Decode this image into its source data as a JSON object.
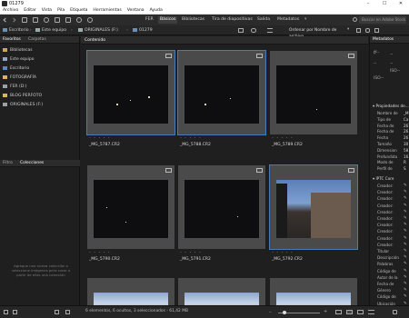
{
  "window": {
    "title": "01279"
  },
  "menu": [
    "Archivo",
    "Editar",
    "Vista",
    "Pila",
    "Etiqueta",
    "Herramientas",
    "Ventana",
    "Ayuda"
  ],
  "workspace": {
    "tabs": [
      "FER",
      "Básicos",
      "Bibliotecas",
      "Tira de diapositivas",
      "Salida",
      "Metadatos"
    ],
    "active": "Básicos",
    "search_placeholder": "Buscar en Adobe Stock"
  },
  "path": {
    "items": [
      "Escritorio",
      "Este equipo",
      "ORIGINALES (F:)",
      "01279"
    ],
    "sort_label": "Ordenar por Nombre de archivo"
  },
  "left_panel": {
    "tabs": [
      "Favoritos",
      "Carpetas"
    ],
    "favorites": [
      {
        "label": "Bibliotecas",
        "color": "#c9a85a"
      },
      {
        "label": "Este equipo",
        "color": "#8fa7c4"
      },
      {
        "label": "Escritorio",
        "color": "#5a86c9"
      },
      {
        "label": "FOTOGRAFÍA",
        "color": "#d9b45a"
      },
      {
        "label": "FER (D:)",
        "color": "#9aa0a6"
      },
      {
        "label": "BLOG PERFOTO",
        "color": "#d9b45a"
      },
      {
        "label": "ORIGINALES (F:)",
        "color": "#9aa0a6"
      }
    ],
    "bottom_tabs": [
      "Filtro",
      "Colecciones"
    ],
    "collections_message": "Agregue una nueva colección o seleccione imágenes para crear a partir de ellas una colección"
  },
  "content": {
    "tab": "Contenido",
    "thumbnails": [
      {
        "name": "_MG_5787.CR2",
        "selected": true
      },
      {
        "name": "_MG_5788.CR2",
        "selected": true
      },
      {
        "name": "_MG_5789.CR2",
        "selected": false
      },
      {
        "name": "_MG_5790.CR2",
        "selected": false
      },
      {
        "name": "_MG_5791.CR2",
        "selected": false
      },
      {
        "name": "_MG_5792.CR2",
        "selected": true
      }
    ]
  },
  "right_panel": {
    "tab": "Metadatos",
    "values": [
      "f/--",
      "--",
      "--",
      "--",
      "ISO--"
    ],
    "file_props_header": "Propiedades de...",
    "file_props": [
      {
        "label": "Nombre de",
        "value": "_M"
      },
      {
        "label": "Tipo de",
        "value": "Ca"
      },
      {
        "label": "Fecha de",
        "value": "26"
      },
      {
        "label": "Fecha de",
        "value": "26"
      },
      {
        "label": "Fecha",
        "value": "26"
      },
      {
        "label": "Tamaño",
        "value": "30"
      },
      {
        "label": "Dimension",
        "value": "58"
      },
      {
        "label": "Profundida",
        "value": "16"
      },
      {
        "label": "Modo de",
        "value": "R"
      },
      {
        "label": "Perfil de",
        "value": "S"
      }
    ],
    "iptc_header": "IPTC Core",
    "iptc_fields": [
      "Creador:",
      "Creador:",
      "Creador:",
      "Creador:",
      "Creador:",
      "Creador:",
      "Creador:",
      "Creador:",
      "Creador:",
      "Creador:",
      "Titular",
      "Descripción",
      "Palabras",
      "Código de",
      "Autor de la",
      "Fecha de",
      "Género",
      "Código de",
      "Ubicación"
    ]
  },
  "status": {
    "text": "6 elementos, 6 ocultos, 3 seleccionados - 61,42 MB",
    "zoom_fraction": 0.15
  }
}
